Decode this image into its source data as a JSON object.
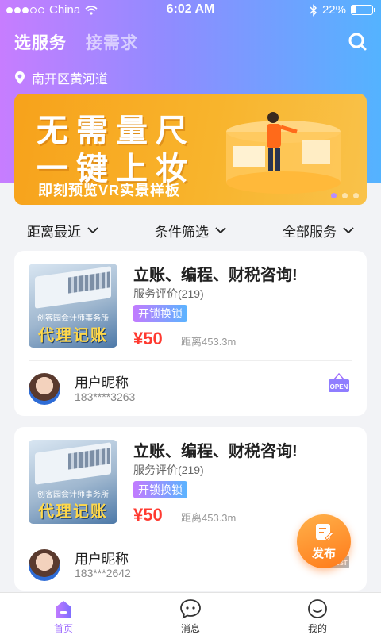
{
  "status_bar": {
    "carrier": "China",
    "time": "6:02 AM",
    "battery": "22%",
    "battery_level": 0.22
  },
  "header": {
    "tabs": [
      {
        "label": "选服务",
        "active": true
      },
      {
        "label": "接需求",
        "active": false
      }
    ],
    "search_icon": "search-icon"
  },
  "location": {
    "text": "南开区黄河道",
    "icon": "location-pin-icon"
  },
  "banner": {
    "line1": "无需量尺",
    "line2": "一键上妆",
    "subtitle": "即刻预览VR实景样板",
    "slide_count": 3,
    "active_slide": 0
  },
  "filters": [
    {
      "label": "距离最近",
      "icon": "chevron-down-icon"
    },
    {
      "label": "条件筛选",
      "icon": "chevron-down-icon"
    },
    {
      "label": "全部服务",
      "icon": "chevron-down-icon"
    }
  ],
  "listings": [
    {
      "thumb_firm": "创客园会计师事务所",
      "thumb_title": "代理记账",
      "title": "立账、编程、财税咨询!",
      "rating": "服务评价(219)",
      "tag": "开锁换锁",
      "price": "¥50",
      "distance": "距离453.3m",
      "user_name": "用户昵称",
      "phone": "183****3263",
      "shop_status": "OPEN"
    },
    {
      "thumb_firm": "创客园会计师事务所",
      "thumb_title": "代理记账",
      "title": "立账、编程、财税咨询!",
      "rating": "服务评价(219)",
      "tag": "开锁换锁",
      "price": "¥50",
      "distance": "距离453.3m",
      "user_name": "用户昵称",
      "phone": "183***2642",
      "shop_status": "REST"
    }
  ],
  "fab": {
    "label": "发布",
    "icon": "edit-icon"
  },
  "tabbar": [
    {
      "label": "首页",
      "icon": "home-icon",
      "active": true
    },
    {
      "label": "消息",
      "icon": "message-icon",
      "active": false
    },
    {
      "label": "我的",
      "icon": "profile-icon",
      "active": false
    }
  ],
  "colors": {
    "accent_purple": "#9f6dff",
    "accent_blue": "#54b3ff",
    "price_red": "#ff3a30",
    "fab_orange": "#ff8a2a"
  }
}
